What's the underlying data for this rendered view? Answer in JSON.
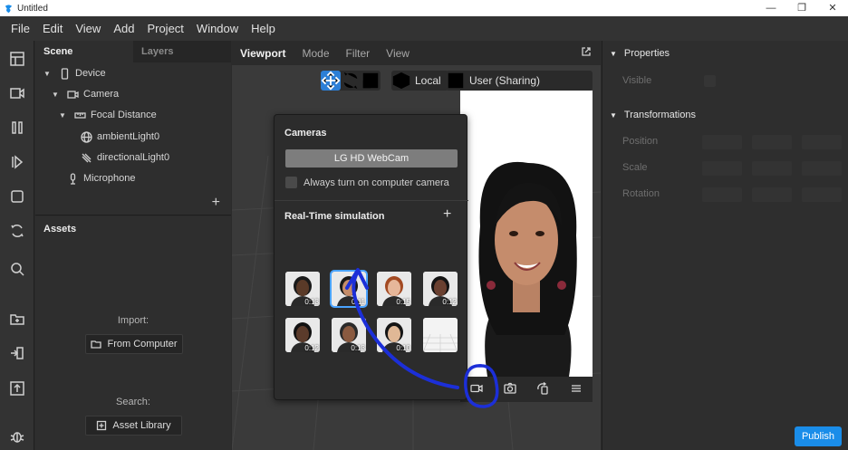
{
  "window": {
    "title": "Untitled",
    "controls": [
      "—",
      "❐",
      "✕"
    ]
  },
  "menubar": [
    "File",
    "Edit",
    "View",
    "Add",
    "Project",
    "Window",
    "Help"
  ],
  "scene_panel": {
    "tabs": [
      "Scene",
      "Layers"
    ],
    "tree": [
      {
        "label": "Device",
        "icon": "phone-icon"
      },
      {
        "label": "Camera",
        "icon": "camera-icon"
      },
      {
        "label": "Focal Distance",
        "icon": "focal-distance-icon"
      },
      {
        "label": "ambientLight0",
        "icon": "globe-icon"
      },
      {
        "label": "directionalLight0",
        "icon": "directional-light-icon"
      },
      {
        "label": "Microphone",
        "icon": "microphone-icon"
      }
    ],
    "add_label": "+"
  },
  "assets_panel": {
    "title": "Assets",
    "import_label": "Import:",
    "from_computer": "From Computer",
    "search_label": "Search:",
    "asset_library": "Asset Library"
  },
  "viewport": {
    "tabs": [
      "Viewport",
      "Mode",
      "Filter",
      "View"
    ],
    "local_label": "Local",
    "user_label": "User (Sharing)"
  },
  "camera_popup": {
    "title": "Cameras",
    "device": "LG HD WebCam",
    "always_on_label": "Always turn on computer camera",
    "sim_title": "Real-Time simulation",
    "add_label": "+",
    "thumbnails": [
      {
        "duration": "0:13",
        "skin": "#5a3a28",
        "hair": "#1a1a1a",
        "bg": "#e9e9e9"
      },
      {
        "duration": "0:11",
        "skin": "#c58d6a",
        "hair": "#181818",
        "bg": "#e9e9e9"
      },
      {
        "duration": "0:15",
        "skin": "#e6b79a",
        "hair": "#a34a22",
        "bg": "#e9e9e9"
      },
      {
        "duration": "0:12",
        "skin": "#6a4030",
        "hair": "#141414",
        "bg": "#e9e9e9"
      },
      {
        "duration": "0:12",
        "skin": "#5b3b2b",
        "hair": "#121212",
        "bg": "#e9e9e9"
      },
      {
        "duration": "0:13",
        "skin": "#8a5a40",
        "hair": "#2a2a2a",
        "bg": "#e9e9e9"
      },
      {
        "duration": "0:10",
        "skin": "#e0b896",
        "hair": "#151515",
        "bg": "#e9e9e9"
      },
      {
        "duration": "",
        "skin": "",
        "hair": "",
        "bg": "#f3f3f3"
      }
    ]
  },
  "properties": {
    "section_properties": "Properties",
    "visible_label": "Visible",
    "section_transformations": "Transformations",
    "rows": [
      "Position",
      "Scale",
      "Rotation"
    ],
    "publish": "Publish"
  },
  "colors": {
    "accent": "#1a8de9",
    "annotation": "#1c2fd8"
  }
}
